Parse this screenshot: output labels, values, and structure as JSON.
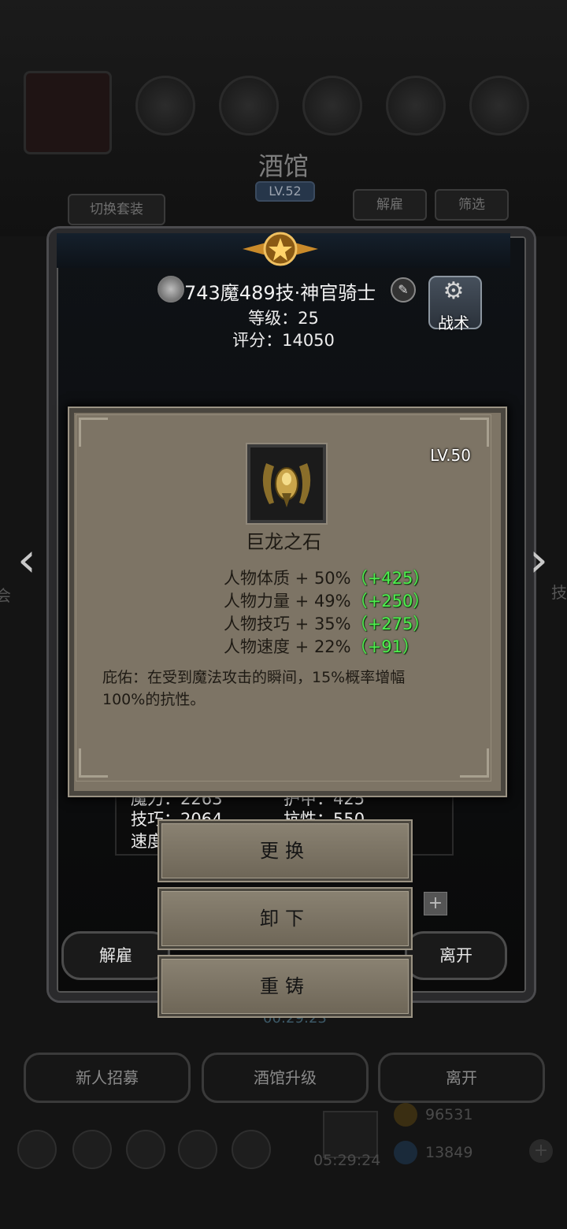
{
  "background": {
    "tavern_title": "酒馆",
    "tavern_level": "LV.52",
    "switch_outfit_label": "切换套装",
    "dismiss_top_label": "解雇",
    "filter_label": "筛选",
    "bottom_buttons": [
      "新人招募",
      "酒馆升级",
      "离开"
    ],
    "gold_amount": "96531",
    "gem_amount": "13849",
    "timer_bottom": "05:29:24",
    "timer_mid": "00:29:23",
    "side_text_left": "会",
    "side_text_right": "技"
  },
  "hero": {
    "name": "743魔489技·神官骑士",
    "level_text": "等级：25",
    "score_text": "评分：14050",
    "tactics_label": "战术",
    "edit_icon": "edit-icon",
    "badge_icon": "hero-badge-icon"
  },
  "item": {
    "level": "LV.50",
    "name": "巨龙之石",
    "icon": "dragon-stone-icon",
    "attributes": [
      {
        "label": "人物体质 + 50%",
        "bonus": "（+425）"
      },
      {
        "label": "人物力量 + 49%",
        "bonus": "（+250）"
      },
      {
        "label": "人物技巧 + 35%",
        "bonus": "（+275）"
      },
      {
        "label": "人物速度 + 22%",
        "bonus": "（+91）"
      }
    ],
    "description": "庇佑：在受到魔法攻击的瞬间，15%概率增幅100%的抗性。"
  },
  "stats": {
    "magic": "魔力：2263",
    "armor": "护甲：425",
    "skill": "技巧：2064",
    "resist": "抗性：550",
    "speed": "速度"
  },
  "actions": {
    "replace_label": "更换",
    "unequip_label": "卸下",
    "reforge_label": "重铸",
    "dismiss_label": "解雇",
    "leave_label": "离开"
  },
  "colors": {
    "bonus_green": "#4ef04e",
    "popup_parchment": "#7d7465",
    "frame_dark": "#2a2a2c"
  }
}
